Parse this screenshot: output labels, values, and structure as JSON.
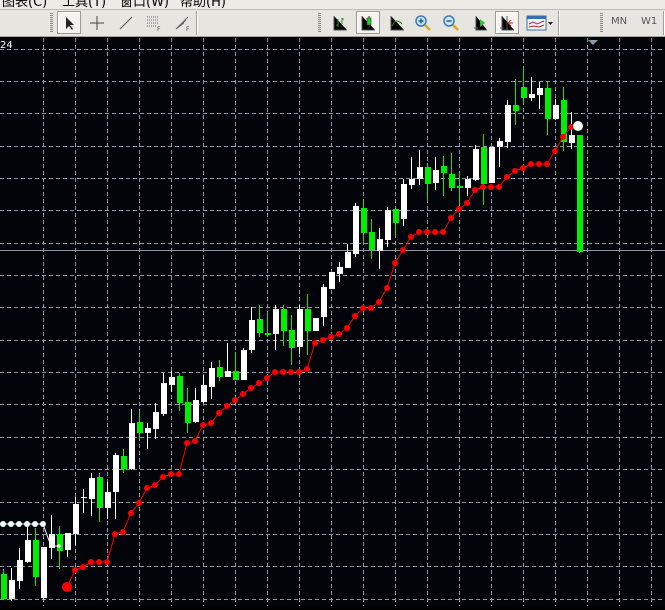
{
  "menu": {
    "items": [
      "图表(C)",
      "工具(T)",
      "窗口(W)",
      "帮助(H)"
    ]
  },
  "toolbar": {
    "left_tools": [
      "cursor-icon",
      "crosshair-icon",
      "trendline-icon",
      "fibo-levels-icon",
      "fibo-fan-icon"
    ],
    "chart_tools": [
      "bar-chart-icon",
      "candlestick-icon",
      "line-chart-icon",
      "zoom-in-icon",
      "zoom-out-icon",
      "autoscroll-icon",
      "chart-shift-icon",
      "templates-icon"
    ],
    "timeframes": [
      "MN",
      "W1"
    ],
    "pressed": [
      "cursor-icon",
      "candlestick-icon",
      "chart-shift-icon"
    ]
  },
  "chart": {
    "date_label": "24",
    "colors": {
      "background": "#03030a",
      "grid": "#8c9aa8",
      "bull": "#ffffff",
      "bear": "#00ee00",
      "sar_up": "#ff0000",
      "sar_down": "#f0fff8",
      "price_line": "#8c9aa8"
    },
    "bid_price": 358,
    "candles": [
      [
        36,
        41,
        10,
        11
      ],
      [
        11,
        42,
        9,
        30
      ],
      [
        29,
        62,
        21,
        50
      ],
      [
        48,
        87,
        47,
        70
      ],
      [
        70,
        82,
        24,
        33
      ],
      [
        12,
        63,
        10,
        63
      ],
      [
        62,
        95,
        51,
        76
      ],
      [
        76,
        84,
        41,
        59
      ],
      [
        60,
        77,
        53,
        77
      ],
      [
        76,
        113,
        65,
        106
      ],
      [
        112,
        121,
        97,
        113
      ],
      [
        111,
        137,
        94,
        132
      ],
      [
        133,
        137,
        88,
        102
      ],
      [
        102,
        128,
        91,
        118
      ],
      [
        118,
        157,
        91,
        155
      ],
      [
        154,
        161,
        137,
        141
      ],
      [
        141,
        201,
        140,
        187
      ],
      [
        188,
        198,
        171,
        177
      ],
      [
        177,
        187,
        161,
        182
      ],
      [
        181,
        207,
        171,
        198
      ],
      [
        196,
        237,
        194,
        227
      ],
      [
        225,
        239,
        218,
        233
      ],
      [
        234,
        237,
        199,
        207
      ],
      [
        208,
        222,
        177,
        187
      ],
      [
        188,
        222,
        187,
        210
      ],
      [
        208,
        235,
        207,
        225
      ],
      [
        223,
        248,
        211,
        242
      ],
      [
        243,
        250,
        229,
        233
      ],
      [
        233,
        267,
        233,
        239
      ],
      [
        239,
        258,
        230,
        230
      ],
      [
        230,
        262,
        230,
        260
      ],
      [
        260,
        303,
        257,
        290
      ],
      [
        291,
        305,
        273,
        277
      ],
      [
        277,
        296,
        273,
        275
      ],
      [
        276,
        305,
        260,
        301
      ],
      [
        301,
        305,
        264,
        279
      ],
      [
        280,
        295,
        245,
        262
      ],
      [
        263,
        305,
        256,
        301
      ],
      [
        301,
        316,
        255,
        279
      ],
      [
        279,
        292,
        279,
        292
      ],
      [
        293,
        326,
        284,
        323
      ],
      [
        321,
        338,
        321,
        338
      ],
      [
        336,
        348,
        328,
        343
      ],
      [
        342,
        366,
        342,
        358
      ],
      [
        356,
        407,
        353,
        404
      ],
      [
        402,
        408,
        367,
        377
      ],
      [
        378,
        391,
        351,
        360
      ],
      [
        359,
        382,
        341,
        371
      ],
      [
        370,
        403,
        363,
        400
      ],
      [
        401,
        403,
        375,
        387
      ],
      [
        391,
        431,
        384,
        426
      ],
      [
        425,
        453,
        421,
        431
      ],
      [
        431,
        460,
        425,
        443
      ],
      [
        443,
        447,
        411,
        426
      ],
      [
        427,
        453,
        420,
        440
      ],
      [
        444,
        454,
        414,
        437
      ],
      [
        436,
        457,
        419,
        422
      ],
      [
        424,
        438,
        398,
        422
      ],
      [
        422,
        434,
        414,
        431
      ],
      [
        430,
        465,
        429,
        461
      ],
      [
        463,
        476,
        405,
        426
      ],
      [
        427,
        463,
        427,
        463
      ],
      [
        463,
        472,
        443,
        469
      ],
      [
        468,
        510,
        462,
        505
      ],
      [
        505,
        531,
        485,
        499
      ],
      [
        523,
        540,
        507,
        512
      ],
      [
        512,
        533,
        509,
        516
      ],
      [
        515,
        528,
        501,
        522
      ],
      [
        522,
        528,
        475,
        491
      ],
      [
        491,
        511,
        490,
        505
      ],
      [
        510,
        523,
        459,
        468
      ],
      [
        467,
        498,
        461,
        475
      ],
      [
        475,
        475,
        357,
        358
      ]
    ],
    "sar_down_start": 0,
    "sar_down": [
      86,
      86,
      86,
      86,
      86,
      86,
      64,
      64
    ],
    "sar_up_start": 8,
    "sar_up": [
      23,
      40,
      43,
      48,
      48,
      48,
      76,
      78,
      97,
      107,
      122,
      125,
      133,
      136,
      136,
      167,
      169,
      185,
      187,
      197,
      204,
      210,
      216,
      222,
      227,
      232,
      238,
      238,
      238,
      238,
      241,
      267,
      270,
      273,
      276,
      282,
      294,
      302,
      302,
      308,
      322,
      347,
      360,
      373,
      378,
      378,
      378,
      378,
      392,
      401,
      407,
      420,
      423,
      423,
      423,
      433,
      439,
      442,
      446,
      446,
      446,
      459,
      473,
      483
    ],
    "sar_reversal": 484
  }
}
